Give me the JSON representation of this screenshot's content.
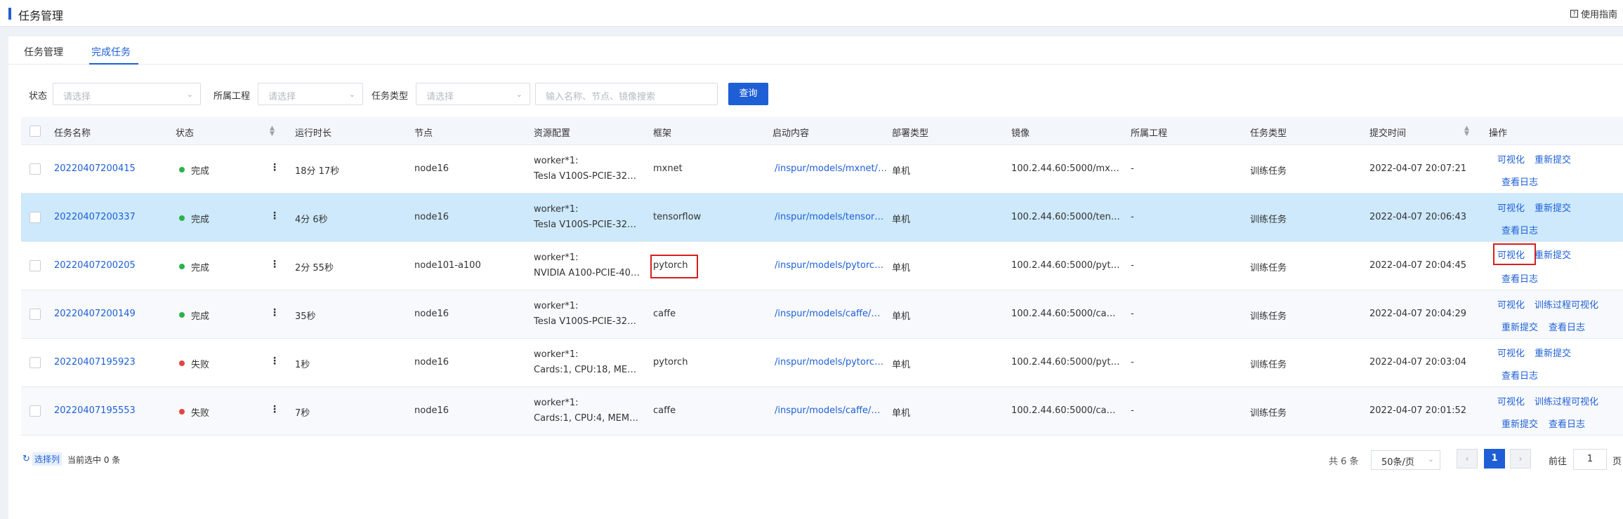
{
  "header": {
    "title": "任务管理",
    "guide_label": "使用指南"
  },
  "tabs": [
    {
      "label": "任务管理"
    },
    {
      "label": "完成任务"
    }
  ],
  "filters": {
    "status_label": "状态",
    "status_placeholder": "请选择",
    "project_label": "所属工程",
    "project_placeholder": "请选择",
    "type_label": "任务类型",
    "type_placeholder": "请选择",
    "search_placeholder": "输入名称、节点、镜像搜索",
    "query_label": "查询"
  },
  "columns": [
    "任务名称",
    "状态",
    "运行时长",
    "节点",
    "资源配置",
    "框架",
    "启动内容",
    "部署类型",
    "镜像",
    "所属工程",
    "任务类型",
    "提交时间",
    "操作"
  ],
  "rows": [
    {
      "name": "20220407200415",
      "status": "完成",
      "duration": "18分 17秒",
      "node": "node16",
      "res1": "worker*1:",
      "res2": "Tesla V100S-PCIE-32…",
      "framework": "mxnet",
      "launch": "/inspur/models/mxnet/mx_",
      "deploy": "单机",
      "image": "100.2.44.60:5000/mxn…",
      "project": "-",
      "type": "训练任务",
      "time": "2022-04-07 20:07:21",
      "op1": "可视化",
      "op2": "重新提交",
      "op3": "查看日志",
      "op4": ""
    },
    {
      "name": "20220407200337",
      "status": "完成",
      "duration": "4分 6秒",
      "node": "node16",
      "res1": "worker*1:",
      "res2": "Tesla V100S-PCIE-32…",
      "framework": "tensorflow",
      "launch": "/inspur/models/tensorflow",
      "deploy": "单机",
      "image": "100.2.44.60:5000/tens…",
      "project": "-",
      "type": "训练任务",
      "time": "2022-04-07 20:06:43",
      "op1": "可视化",
      "op2": "重新提交",
      "op3": "查看日志",
      "op4": ""
    },
    {
      "name": "20220407200205",
      "status": "完成",
      "duration": "2分 55秒",
      "node": "node101-a100",
      "res1": "worker*1:",
      "res2": "NVIDIA A100-PCIE-40…",
      "framework": "pytorch",
      "launch": "/inspur/models/pytorch/m",
      "deploy": "单机",
      "image": "100.2.44.60:5000/pyto…",
      "project": "-",
      "type": "训练任务",
      "time": "2022-04-07 20:04:45",
      "op1": "可视化",
      "op2": "重新提交",
      "op3": "查看日志",
      "op4": ""
    },
    {
      "name": "20220407200149",
      "status": "完成",
      "duration": "35秒",
      "node": "node16",
      "res1": "worker*1:",
      "res2": "Tesla V100S-PCIE-32…",
      "framework": "caffe",
      "launch": "/inspur/models/caffe/mnis",
      "deploy": "单机",
      "image": "100.2.44.60:5000/caff…",
      "project": "-",
      "type": "训练任务",
      "time": "2022-04-07 20:04:29",
      "op1": "可视化",
      "op2": "训练过程可视化",
      "op3": "重新提交",
      "op4": "查看日志"
    },
    {
      "name": "20220407195923",
      "status": "失败",
      "duration": "1秒",
      "node": "node16",
      "res1": "worker*1:",
      "res2": "Cards:1, CPU:18, ME…",
      "framework": "pytorch",
      "launch": "/inspur/models/pytorch/m",
      "deploy": "单机",
      "image": "100.2.44.60:5000/pyto…",
      "project": "-",
      "type": "训练任务",
      "time": "2022-04-07 20:03:04",
      "op1": "可视化",
      "op2": "重新提交",
      "op3": "查看日志",
      "op4": ""
    },
    {
      "name": "20220407195553",
      "status": "失败",
      "duration": "7秒",
      "node": "node16",
      "res1": "worker*1:",
      "res2": "Cards:1, CPU:4, MEM…",
      "framework": "caffe",
      "launch": "/inspur/models/caffe/mnis",
      "deploy": "单机",
      "image": "100.2.44.60:5000/caff…",
      "project": "-",
      "type": "训练任务",
      "time": "2022-04-07 20:01:52",
      "op1": "可视化",
      "op2": "训练过程可视化",
      "op3": "重新提交",
      "op4": "查看日志"
    }
  ],
  "footer": {
    "select_col_label": "选择列",
    "selected_text": "当前选中 0 条",
    "total_text": "共 6 条",
    "page_size": "50条/页",
    "current_page": "1",
    "goto_label": "前往",
    "goto_value": "1",
    "page_suffix": "页"
  },
  "colors": {
    "accent": "#1e5fd6",
    "success": "#2bb24c",
    "fail": "#e5443e",
    "highlight_row": "#cde9fb",
    "annotation_box": "#d81e1e"
  }
}
